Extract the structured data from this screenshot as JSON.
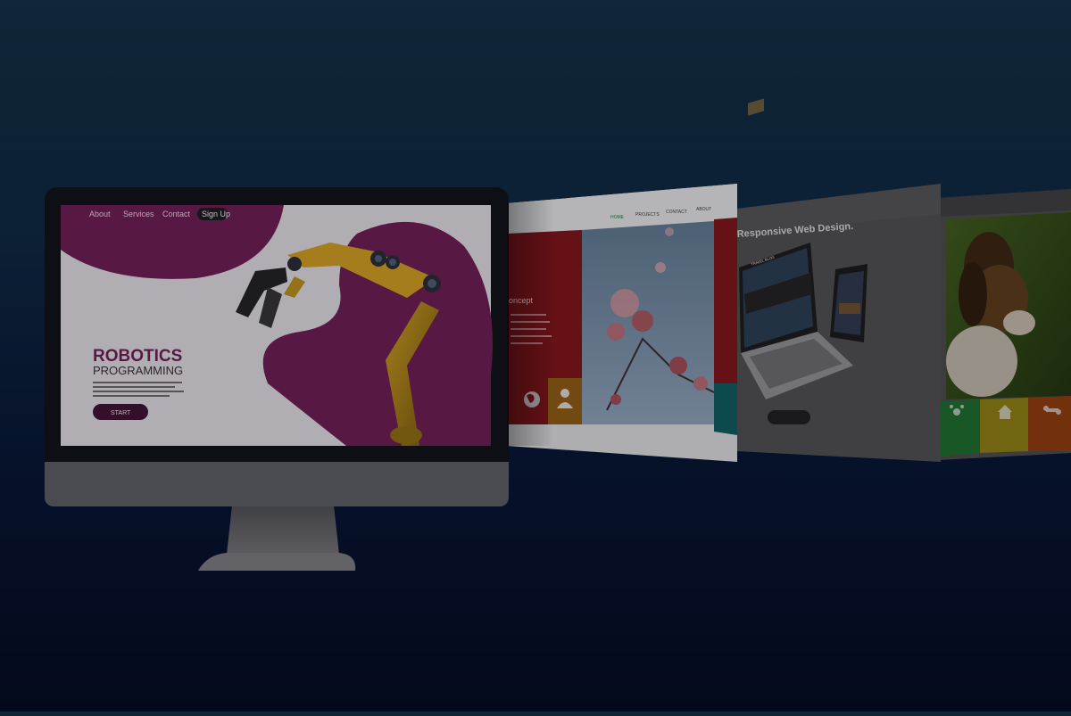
{
  "colors": {
    "accent_purple": "#6a1d4e",
    "robot_yellow": "#b38a1a",
    "panel_red": "#7a1416",
    "panel_orange": "#8a5a10",
    "panel_teal": "#0e5a5a",
    "background_top": "#0d2536",
    "background_bottom": "#030a1c"
  },
  "monitor_site": {
    "nav": [
      "About",
      "Services",
      "Contact",
      "Sign Up"
    ],
    "title_line1": "ROBOTICS",
    "title_line2": "PROGRAMMING",
    "cta": "START"
  },
  "card1": {
    "nav": [
      "HOME",
      "PROJECTS",
      "CONTACT",
      "ABOUT"
    ],
    "heading_fragment": "oncept",
    "icons": [
      "globe-icon",
      "user-icon"
    ]
  },
  "card2": {
    "heading": "Responsive Web Design.",
    "laptop_header": "TRAVEL BLOG"
  },
  "card3": {
    "icons": [
      "paw-icon",
      "house-icon",
      "bone-icon"
    ]
  }
}
